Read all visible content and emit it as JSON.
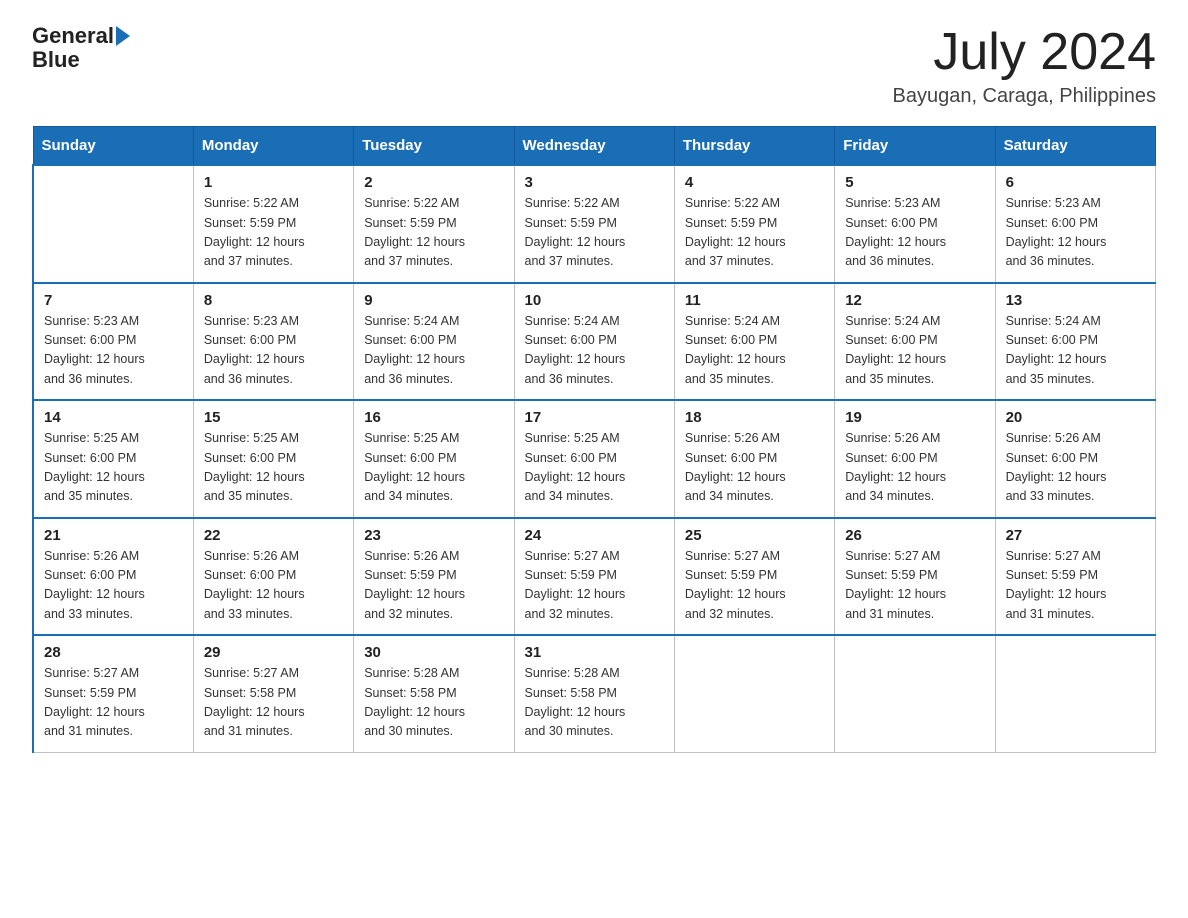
{
  "header": {
    "logo_general": "General",
    "logo_blue": "Blue",
    "month_year": "July 2024",
    "location": "Bayugan, Caraga, Philippines"
  },
  "days_of_week": [
    "Sunday",
    "Monday",
    "Tuesday",
    "Wednesday",
    "Thursday",
    "Friday",
    "Saturday"
  ],
  "weeks": [
    [
      {
        "day": "",
        "info": ""
      },
      {
        "day": "1",
        "info": "Sunrise: 5:22 AM\nSunset: 5:59 PM\nDaylight: 12 hours\nand 37 minutes."
      },
      {
        "day": "2",
        "info": "Sunrise: 5:22 AM\nSunset: 5:59 PM\nDaylight: 12 hours\nand 37 minutes."
      },
      {
        "day": "3",
        "info": "Sunrise: 5:22 AM\nSunset: 5:59 PM\nDaylight: 12 hours\nand 37 minutes."
      },
      {
        "day": "4",
        "info": "Sunrise: 5:22 AM\nSunset: 5:59 PM\nDaylight: 12 hours\nand 37 minutes."
      },
      {
        "day": "5",
        "info": "Sunrise: 5:23 AM\nSunset: 6:00 PM\nDaylight: 12 hours\nand 36 minutes."
      },
      {
        "day": "6",
        "info": "Sunrise: 5:23 AM\nSunset: 6:00 PM\nDaylight: 12 hours\nand 36 minutes."
      }
    ],
    [
      {
        "day": "7",
        "info": "Sunrise: 5:23 AM\nSunset: 6:00 PM\nDaylight: 12 hours\nand 36 minutes."
      },
      {
        "day": "8",
        "info": "Sunrise: 5:23 AM\nSunset: 6:00 PM\nDaylight: 12 hours\nand 36 minutes."
      },
      {
        "day": "9",
        "info": "Sunrise: 5:24 AM\nSunset: 6:00 PM\nDaylight: 12 hours\nand 36 minutes."
      },
      {
        "day": "10",
        "info": "Sunrise: 5:24 AM\nSunset: 6:00 PM\nDaylight: 12 hours\nand 36 minutes."
      },
      {
        "day": "11",
        "info": "Sunrise: 5:24 AM\nSunset: 6:00 PM\nDaylight: 12 hours\nand 35 minutes."
      },
      {
        "day": "12",
        "info": "Sunrise: 5:24 AM\nSunset: 6:00 PM\nDaylight: 12 hours\nand 35 minutes."
      },
      {
        "day": "13",
        "info": "Sunrise: 5:24 AM\nSunset: 6:00 PM\nDaylight: 12 hours\nand 35 minutes."
      }
    ],
    [
      {
        "day": "14",
        "info": "Sunrise: 5:25 AM\nSunset: 6:00 PM\nDaylight: 12 hours\nand 35 minutes."
      },
      {
        "day": "15",
        "info": "Sunrise: 5:25 AM\nSunset: 6:00 PM\nDaylight: 12 hours\nand 35 minutes."
      },
      {
        "day": "16",
        "info": "Sunrise: 5:25 AM\nSunset: 6:00 PM\nDaylight: 12 hours\nand 34 minutes."
      },
      {
        "day": "17",
        "info": "Sunrise: 5:25 AM\nSunset: 6:00 PM\nDaylight: 12 hours\nand 34 minutes."
      },
      {
        "day": "18",
        "info": "Sunrise: 5:26 AM\nSunset: 6:00 PM\nDaylight: 12 hours\nand 34 minutes."
      },
      {
        "day": "19",
        "info": "Sunrise: 5:26 AM\nSunset: 6:00 PM\nDaylight: 12 hours\nand 34 minutes."
      },
      {
        "day": "20",
        "info": "Sunrise: 5:26 AM\nSunset: 6:00 PM\nDaylight: 12 hours\nand 33 minutes."
      }
    ],
    [
      {
        "day": "21",
        "info": "Sunrise: 5:26 AM\nSunset: 6:00 PM\nDaylight: 12 hours\nand 33 minutes."
      },
      {
        "day": "22",
        "info": "Sunrise: 5:26 AM\nSunset: 6:00 PM\nDaylight: 12 hours\nand 33 minutes."
      },
      {
        "day": "23",
        "info": "Sunrise: 5:26 AM\nSunset: 5:59 PM\nDaylight: 12 hours\nand 32 minutes."
      },
      {
        "day": "24",
        "info": "Sunrise: 5:27 AM\nSunset: 5:59 PM\nDaylight: 12 hours\nand 32 minutes."
      },
      {
        "day": "25",
        "info": "Sunrise: 5:27 AM\nSunset: 5:59 PM\nDaylight: 12 hours\nand 32 minutes."
      },
      {
        "day": "26",
        "info": "Sunrise: 5:27 AM\nSunset: 5:59 PM\nDaylight: 12 hours\nand 31 minutes."
      },
      {
        "day": "27",
        "info": "Sunrise: 5:27 AM\nSunset: 5:59 PM\nDaylight: 12 hours\nand 31 minutes."
      }
    ],
    [
      {
        "day": "28",
        "info": "Sunrise: 5:27 AM\nSunset: 5:59 PM\nDaylight: 12 hours\nand 31 minutes."
      },
      {
        "day": "29",
        "info": "Sunrise: 5:27 AM\nSunset: 5:58 PM\nDaylight: 12 hours\nand 31 minutes."
      },
      {
        "day": "30",
        "info": "Sunrise: 5:28 AM\nSunset: 5:58 PM\nDaylight: 12 hours\nand 30 minutes."
      },
      {
        "day": "31",
        "info": "Sunrise: 5:28 AM\nSunset: 5:58 PM\nDaylight: 12 hours\nand 30 minutes."
      },
      {
        "day": "",
        "info": ""
      },
      {
        "day": "",
        "info": ""
      },
      {
        "day": "",
        "info": ""
      }
    ]
  ]
}
